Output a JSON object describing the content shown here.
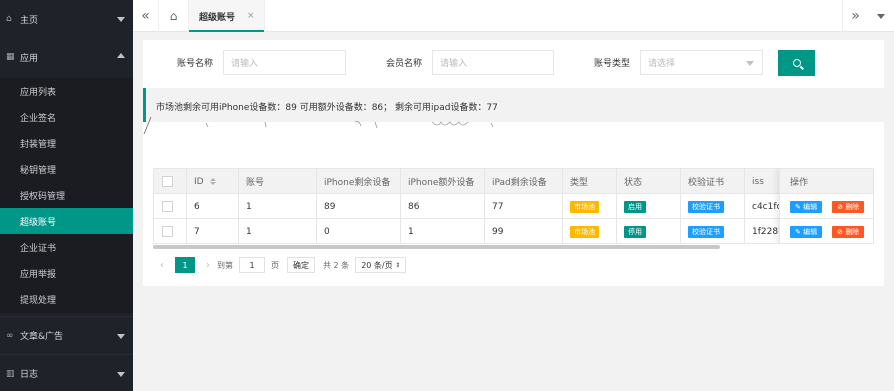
{
  "sidebar": {
    "home": {
      "icon": "home-icon",
      "label": "主页"
    },
    "apps": {
      "icon": "apps-icon",
      "label": "应用"
    },
    "app_items": [
      {
        "label": "应用列表"
      },
      {
        "label": "企业签名"
      },
      {
        "label": "封装管理"
      },
      {
        "label": "秘钥管理"
      },
      {
        "label": "授权码管理"
      },
      {
        "label": "超级账号"
      },
      {
        "label": "企业证书"
      },
      {
        "label": "应用举报"
      },
      {
        "label": "提现处理"
      }
    ],
    "articles": {
      "icon": "articles-icon",
      "label": "文章&广告"
    },
    "logs": {
      "icon": "log-icon",
      "label": "日志"
    }
  },
  "topbar": {
    "tab_label": "超级账号",
    "tab_close": "×",
    "left_arrow": "«",
    "right_arrow": "»"
  },
  "filters": {
    "account_name_label": "账号名称",
    "account_name_placeholder": "请输入",
    "member_name_label": "会员名称",
    "member_name_placeholder": "请输入",
    "account_type_label": "账号类型",
    "account_type_placeholder": "请选择"
  },
  "notice": "市场池剩余可用iPhone设备数：89 可用额外设备数：86； 剩余可用ipad设备数：77",
  "table": {
    "headers": [
      "ID",
      "账号",
      "iPhone剩余设备",
      "iPhone额外设备",
      "iPad剩余设备",
      "类型",
      "状态",
      "校验证书",
      "iss",
      "操作"
    ],
    "rows": [
      {
        "id": "6",
        "account": "1",
        "iphone_left": "89",
        "iphone_extra": "86",
        "ipad_left": "77",
        "type": "市场池",
        "status": "启用",
        "cert": "校验证书",
        "iss": "c4c1fca",
        "edit": "编辑",
        "delete": "删除"
      },
      {
        "id": "7",
        "account": "1",
        "iphone_left": "0",
        "iphone_extra": "1",
        "ipad_left": "99",
        "type": "市场池",
        "status": "停用",
        "cert": "校验证书",
        "iss": "1f228b4",
        "edit": "编辑",
        "delete": "删除"
      }
    ]
  },
  "pager": {
    "current": "1",
    "goto_label": "到第",
    "goto_value": "1",
    "page_label": "页",
    "confirm": "确定",
    "total": "共 2 条",
    "per_page": "20 条/页"
  }
}
